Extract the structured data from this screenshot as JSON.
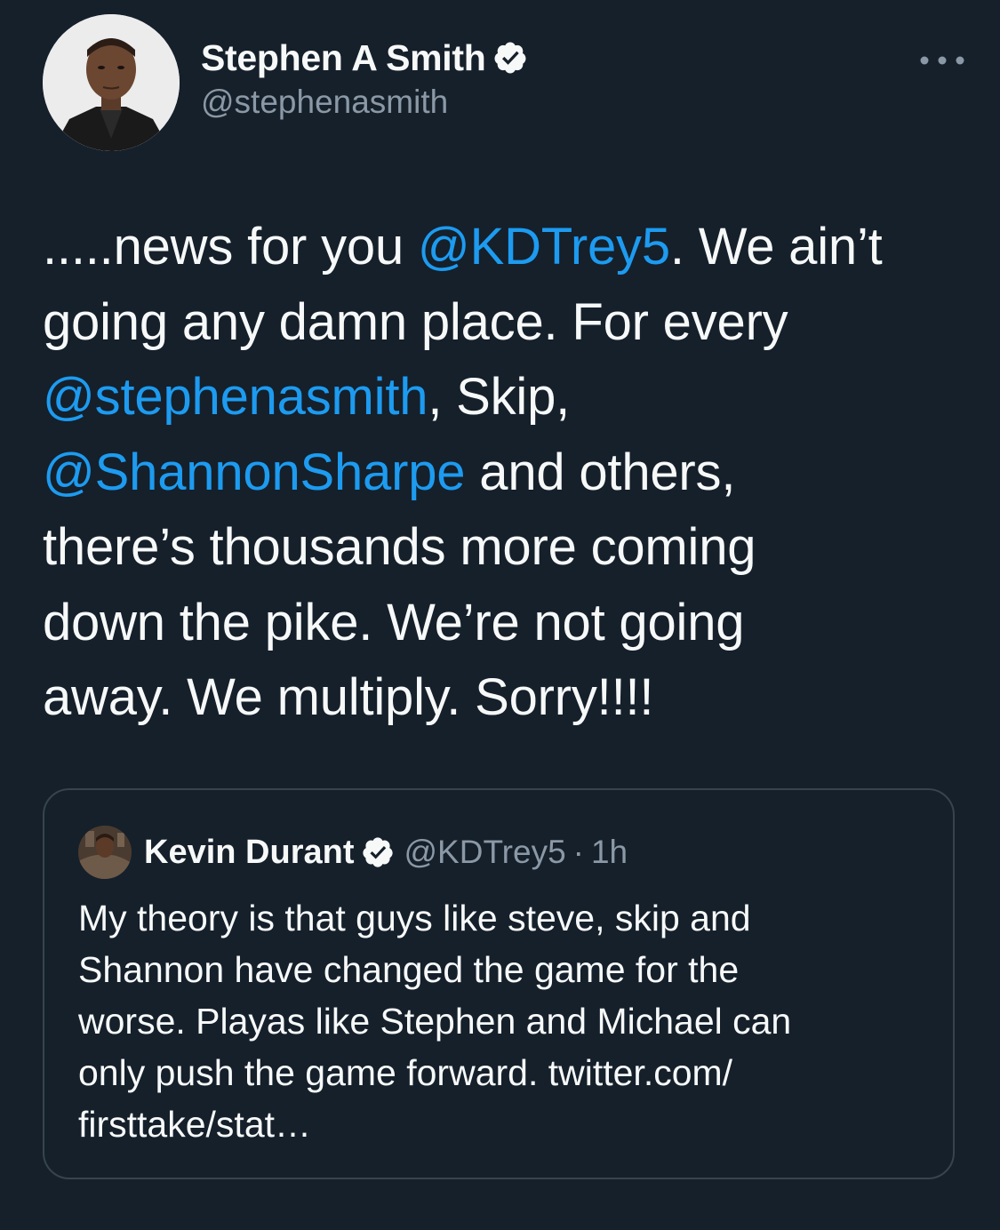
{
  "tweet": {
    "author": {
      "display_name": "Stephen A Smith",
      "handle": "@stephenasmith",
      "verified": true,
      "avatar": "profile-photo"
    },
    "more_icon": "ellipsis-icon",
    "text_segments": [
      ".....news for you ",
      "@KDTrey5",
      ". We ain’t",
      "going any damn place. For every",
      "@stephenasmith",
      ", Skip,",
      "@ShannonSharpe",
      " and others,",
      "there’s thousands more coming",
      "down the pike. We’re not going",
      "away. We multiply. Sorry!!!!"
    ]
  },
  "quoted_tweet": {
    "author": {
      "display_name": "Kevin Durant",
      "handle": "@KDTrey5",
      "verified": true,
      "avatar": "profile-photo"
    },
    "separator": "·",
    "time": "1h",
    "text_lines": [
      "My theory is that guys like steve, skip and",
      "Shannon have changed the game for the",
      "worse. Playas like Stephen and Michael can",
      "only push the game forward. twitter.com/",
      "firsttake/stat…"
    ]
  },
  "colors": {
    "background": "#15202b",
    "text": "#f7f9f9",
    "secondary_text": "#8b98a5",
    "link": "#1d9bf0",
    "border": "#38444d"
  }
}
